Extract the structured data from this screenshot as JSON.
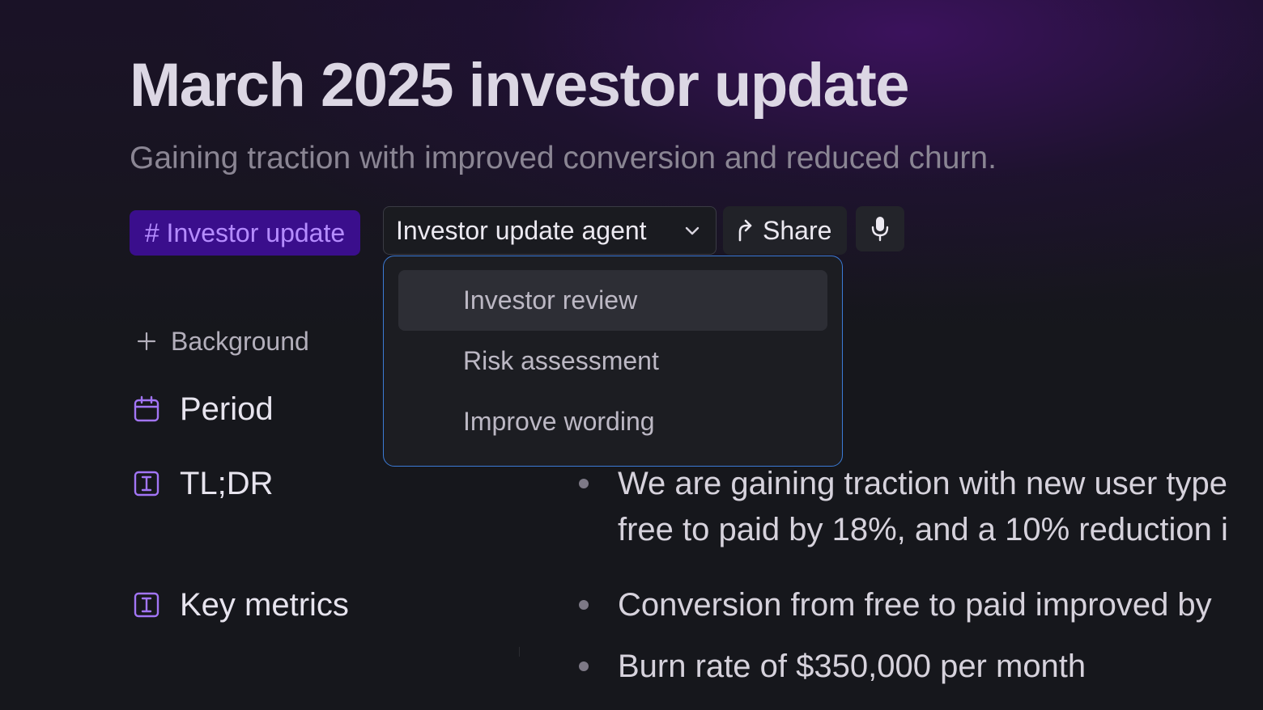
{
  "document": {
    "title": "March 2025 investor update",
    "subtitle": "Gaining traction with improved conversion and reduced churn."
  },
  "toolbar": {
    "tag_label": "# Investor update",
    "agent_select_label": "Investor update agent",
    "share_label": "Share",
    "icons": {
      "agent_select": "chevron-down-icon",
      "share": "share-arrow-icon",
      "mic": "microphone-icon"
    }
  },
  "agent_menu": {
    "items": [
      {
        "label": "Investor review",
        "highlighted": true
      },
      {
        "label": "Risk assessment",
        "highlighted": false
      },
      {
        "label": "Improve wording",
        "highlighted": false
      }
    ]
  },
  "properties": {
    "add_background_label": "Background",
    "rows": [
      {
        "label": "Period",
        "icon": "calendar-icon"
      },
      {
        "label": "TL;DR",
        "icon": "text-field-icon"
      },
      {
        "label": "Key metrics",
        "icon": "text-field-icon"
      }
    ]
  },
  "content": {
    "tldr": [
      "We are gaining traction with new user type",
      "free to paid by 18%, and a 10% reduction i"
    ],
    "key_metrics": [
      "Conversion from free to paid improved by",
      "Burn rate of $350,000 per month"
    ]
  },
  "colors": {
    "background": "#16171c",
    "accent_purple": "#b58cff",
    "tag_background": "#3a0e8c",
    "dropdown_border": "#3b7bd6"
  }
}
